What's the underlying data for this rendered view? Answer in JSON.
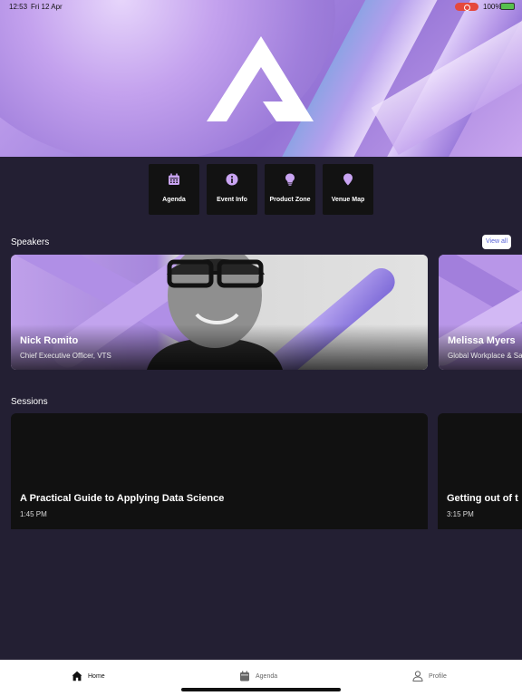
{
  "status_bar": {
    "time": "12:53",
    "date": "Fri 12 Apr",
    "battery": "100%"
  },
  "hero": {
    "logo_icon": "brand-a-logo"
  },
  "quick_actions": [
    {
      "label": "Agenda",
      "icon": "calendar-icon"
    },
    {
      "label": "Event Info",
      "icon": "info-icon"
    },
    {
      "label": "Product Zone",
      "icon": "lightbulb-icon"
    },
    {
      "label": "Venue Map",
      "icon": "map-pin-icon"
    }
  ],
  "speakers": {
    "title": "Speakers",
    "view_all_label": "View all",
    "items": [
      {
        "name": "Nick Romito",
        "role": "Chief Executive Officer, VTS"
      },
      {
        "name": "Melissa Myers",
        "role": "Global Workplace & Sa"
      }
    ]
  },
  "sessions": {
    "title": "Sessions",
    "items": [
      {
        "title": "A Practical Guide to Applying Data Science",
        "time": "1:45 PM"
      },
      {
        "title": "Getting out of t",
        "time": "3:15 PM"
      }
    ]
  },
  "tab_bar": {
    "tabs": [
      {
        "label": "Home",
        "icon": "home-icon",
        "active": true
      },
      {
        "label": "Agenda",
        "icon": "calendar-icon",
        "active": false
      },
      {
        "label": "Profile",
        "icon": "person-icon",
        "active": false
      }
    ]
  },
  "colors": {
    "background": "#231f33",
    "card": "#121212",
    "accent_purple": "#c9a4f2",
    "link_blue": "#5a64d8"
  }
}
